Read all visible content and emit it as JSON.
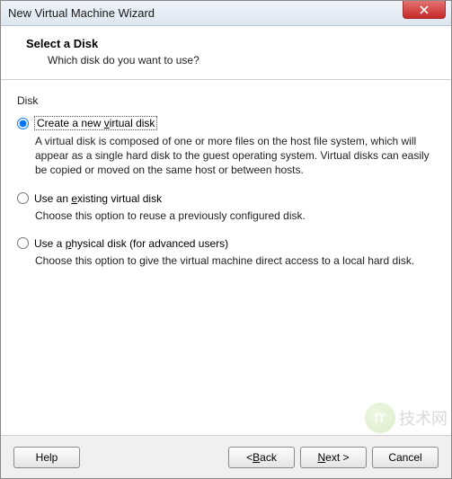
{
  "titlebar": {
    "title": "New Virtual Machine Wizard"
  },
  "header": {
    "title": "Select a Disk",
    "subtitle": "Which disk do you want to use?"
  },
  "group_label": "Disk",
  "options": [
    {
      "label": "Create a new virtual disk",
      "desc": "A virtual disk is composed of one or more files on the host file system, which will appear as a single hard disk to the guest operating system. Virtual disks can easily be copied or moved on the same host or between hosts.",
      "selected": true
    },
    {
      "label": "Use an existing virtual disk",
      "desc": "Choose this option to reuse a previously configured disk.",
      "selected": false
    },
    {
      "label": "Use a physical disk (for advanced users)",
      "desc": "Choose this option to give the virtual machine direct access to a local hard disk.",
      "selected": false
    }
  ],
  "buttons": {
    "help": "Help",
    "back": "< Back",
    "next": "Next >",
    "cancel": "Cancel"
  },
  "watermark": {
    "bubble": "IT",
    "text": "技术网"
  }
}
